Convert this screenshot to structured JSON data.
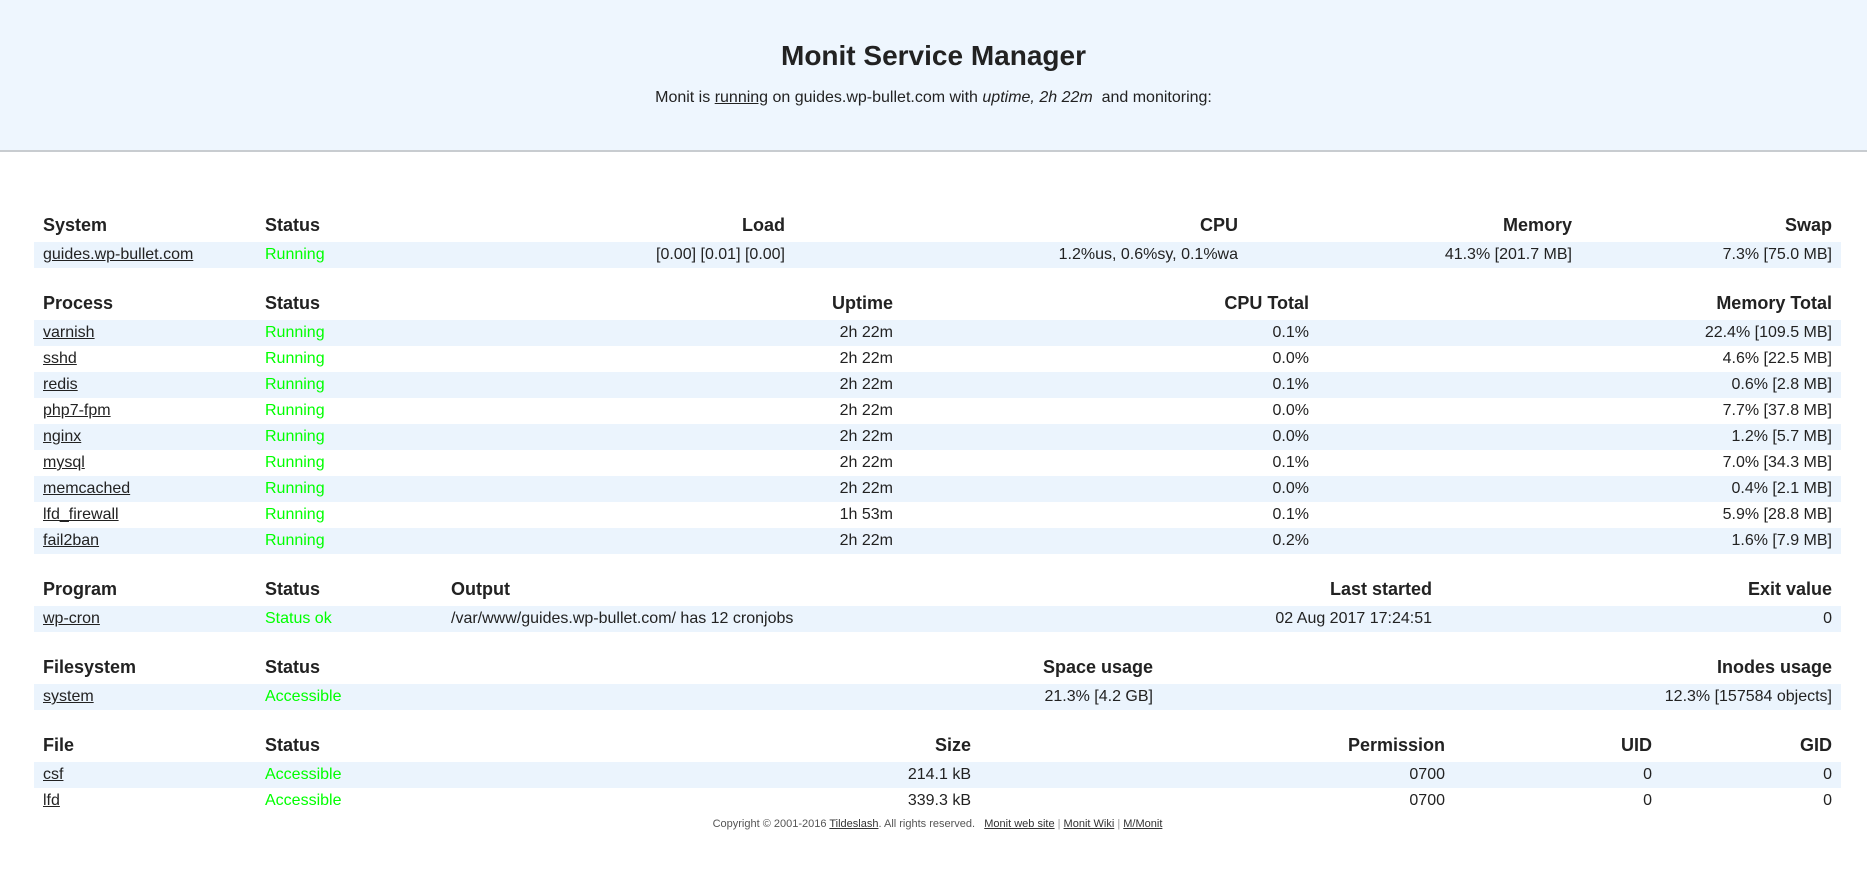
{
  "header": {
    "title": "Monit Service Manager",
    "sub_prefix": "Monit is",
    "sub_running_link": "running",
    "sub_middle": "on guides.wp-bullet.com with",
    "sub_uptime": "uptime, 2h 22m",
    "sub_suffix": "and monitoring:"
  },
  "system": {
    "headers": [
      "System",
      "Status",
      "Load",
      "CPU",
      "Memory",
      "Swap"
    ],
    "rows": [
      {
        "name": "guides.wp-bullet.com",
        "status": "Running",
        "load": "[0.00] [0.01] [0.00]",
        "cpu": "1.2%us, 0.6%sy, 0.1%wa",
        "memory": "41.3% [201.7 MB]",
        "swap": "7.3% [75.0 MB]"
      }
    ]
  },
  "process": {
    "headers": [
      "Process",
      "Status",
      "Uptime",
      "CPU Total",
      "Memory Total"
    ],
    "rows": [
      {
        "name": "varnish",
        "status": "Running",
        "uptime": "2h 22m",
        "cpu": "0.1%",
        "memory": "22.4% [109.5 MB]"
      },
      {
        "name": "sshd",
        "status": "Running",
        "uptime": "2h 22m",
        "cpu": "0.0%",
        "memory": "4.6% [22.5 MB]"
      },
      {
        "name": "redis",
        "status": "Running",
        "uptime": "2h 22m",
        "cpu": "0.1%",
        "memory": "0.6% [2.8 MB]"
      },
      {
        "name": "php7-fpm",
        "status": "Running",
        "uptime": "2h 22m",
        "cpu": "0.0%",
        "memory": "7.7% [37.8 MB]"
      },
      {
        "name": "nginx",
        "status": "Running",
        "uptime": "2h 22m",
        "cpu": "0.0%",
        "memory": "1.2% [5.7 MB]"
      },
      {
        "name": "mysql",
        "status": "Running",
        "uptime": "2h 22m",
        "cpu": "0.1%",
        "memory": "7.0% [34.3 MB]"
      },
      {
        "name": "memcached",
        "status": "Running",
        "uptime": "2h 22m",
        "cpu": "0.0%",
        "memory": "0.4% [2.1 MB]"
      },
      {
        "name": "lfd_firewall",
        "status": "Running",
        "uptime": "1h 53m",
        "cpu": "0.1%",
        "memory": "5.9% [28.8 MB]"
      },
      {
        "name": "fail2ban",
        "status": "Running",
        "uptime": "2h 22m",
        "cpu": "0.2%",
        "memory": "1.6% [7.9 MB]"
      }
    ]
  },
  "program": {
    "headers": [
      "Program",
      "Status",
      "Output",
      "Last started",
      "Exit value"
    ],
    "rows": [
      {
        "name": "wp-cron",
        "status": "Status ok",
        "output": "/var/www/guides.wp-bullet.com/ has 12 cronjobs",
        "last_started": "02 Aug 2017 17:24:51",
        "exit_value": "0"
      }
    ]
  },
  "filesystem": {
    "headers": [
      "Filesystem",
      "Status",
      "Space usage",
      "Inodes usage"
    ],
    "rows": [
      {
        "name": "system",
        "status": "Accessible",
        "space": "21.3% [4.2 GB]",
        "inodes": "12.3% [157584 objects]"
      }
    ]
  },
  "file": {
    "headers": [
      "File",
      "Status",
      "Size",
      "Permission",
      "UID",
      "GID"
    ],
    "rows": [
      {
        "name": "csf",
        "status": "Accessible",
        "size": "214.1 kB",
        "permission": "0700",
        "uid": "0",
        "gid": "0"
      },
      {
        "name": "lfd",
        "status": "Accessible",
        "size": "339.3 kB",
        "permission": "0700",
        "uid": "0",
        "gid": "0"
      }
    ]
  },
  "footer": {
    "copyright_prefix": "Copyright © 2001-2016",
    "company_link": "Tildeslash",
    "copyright_suffix": ". All rights reserved.",
    "links": [
      "Monit web site",
      "Monit Wiki",
      "M/Monit"
    ],
    "separator": "|"
  },
  "colors": {
    "status_ok": "#00ff00",
    "header_bg": "#eef6fe",
    "row_alt_bg": "#ebf4fd"
  }
}
